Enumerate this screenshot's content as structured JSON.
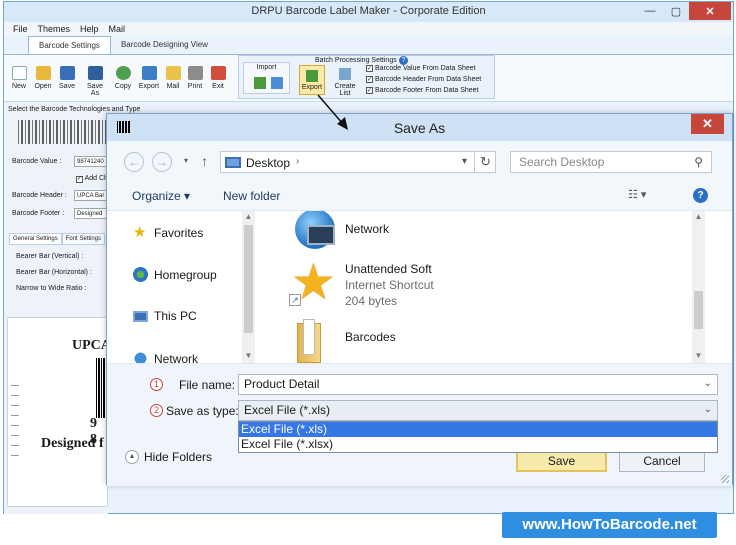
{
  "app": {
    "title": "DRPU Barcode Label Maker - Corporate Edition",
    "menu": [
      "File",
      "Themes",
      "Help",
      "Mail"
    ],
    "tabs": [
      "Barcode Settings",
      "Barcode Designing View"
    ],
    "toolbar": [
      "New",
      "Open",
      "Save",
      "Save As",
      "Copy",
      "Export",
      "Mail",
      "Print",
      "Exit"
    ],
    "batch": {
      "title": "Batch Processing Settings",
      "help": "?",
      "import_label": "Import",
      "export_label": "Export",
      "create_list_label": "Create List",
      "options": [
        "Barcode Value From Data Sheet",
        "Barcode Header From Data Sheet",
        "Barcode Footer From Data Sheet"
      ]
    },
    "left_panel": {
      "heading": "Select the Barcode Technologies and Type",
      "barcode_value_label": "Barcode Value :",
      "barcode_value": "98741240",
      "add_checksum_label": "Add Ch",
      "barcode_header_label": "Barcode Header :",
      "barcode_header": "UPCA Bar",
      "barcode_footer_label": "Barcode Footer :",
      "barcode_footer": "Designed",
      "subtabs": [
        "General Settings",
        "Font Settings"
      ],
      "fields": [
        "Bearer Bar (Vertical) :",
        "Bearer Bar (Horizontal) :",
        "Narrow to Wide Ratio :"
      ]
    },
    "preview": {
      "header": "UPCA",
      "number": "9 8",
      "footer": "Designed f"
    }
  },
  "dialog": {
    "title": "Save As",
    "close": "✕",
    "address": {
      "location": "Desktop",
      "crumb": "›"
    },
    "search_placeholder": "Search Desktop",
    "organize": "Organize ▾",
    "new_folder": "New folder",
    "help": "?",
    "nav_pane": [
      "Favorites",
      "Homegroup",
      "This PC",
      "Network"
    ],
    "files": [
      {
        "name": "Network",
        "sub1": "",
        "sub2": ""
      },
      {
        "name": "Unattended Soft",
        "sub1": "Internet Shortcut",
        "sub2": "204 bytes"
      },
      {
        "name": "Barcodes",
        "sub1": "",
        "sub2": ""
      }
    ],
    "file_name_step": "1",
    "file_name_label": "File name:",
    "file_name_value": "Product Detail",
    "save_type_step": "2",
    "save_type_label": "Save as type:",
    "save_type_value": "Excel File (*.xls)",
    "save_type_options": [
      "Excel File (*.xls)",
      "Excel File (*.xlsx)"
    ],
    "hide_folders": "Hide Folders",
    "save_button": "Save",
    "cancel_button": "Cancel"
  },
  "watermark": "www.HowToBarcode.net",
  "colors": {
    "accent": "#3578e5",
    "close_red": "#c7463b",
    "save_highlight": "#f6e9a9",
    "watermark_bg": "#2f8ee0"
  }
}
